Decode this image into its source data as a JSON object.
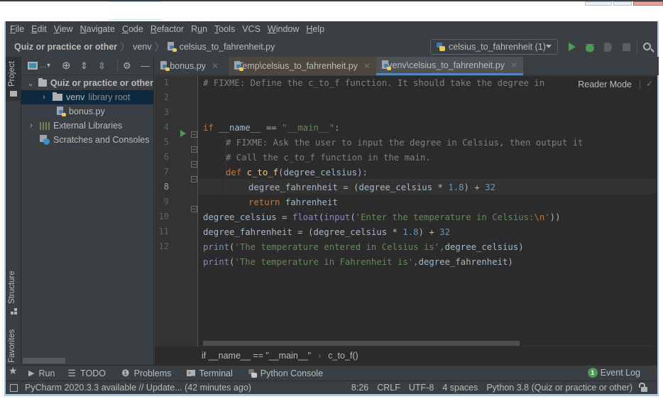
{
  "menu": [
    "File",
    "Edit",
    "View",
    "Navigate",
    "Code",
    "Refactor",
    "Run",
    "Tools",
    "VCS",
    "Window",
    "Help"
  ],
  "menu_mnemonics": [
    "F",
    "E",
    "V",
    "N",
    "C",
    "R",
    "u",
    "T",
    "",
    "W",
    "H"
  ],
  "navbar": {
    "breadcrumbs": [
      "Quiz or practice or other",
      "venv",
      "celsius_to_fahrenheit.py"
    ],
    "run_config": "celsius_to_fahrenheit (1)"
  },
  "left_strip": {
    "project": "Project",
    "structure": "Structure",
    "favorites": "Favorites"
  },
  "project_tree": {
    "root": "Quiz or practice or other",
    "venv": "venv",
    "venv_hint": "library root",
    "file": "bonus.py",
    "external": "External Libraries",
    "scratches": "Scratches and Consoles"
  },
  "tabs": [
    {
      "label": "bonus.py",
      "active": false
    },
    {
      "label": "Temp\\celsius_to_fahrenheit.py",
      "active": false
    },
    {
      "label": "venv\\celsius_to_fahrenheit.py",
      "active": true
    }
  ],
  "editor": {
    "reader_mode": "Reader Mode",
    "current_line": 8,
    "line_numbers": [
      "1",
      "2",
      "3",
      "4",
      "5",
      "6",
      "7",
      "8",
      "9",
      "10",
      "11",
      "12"
    ],
    "lines": {
      "l1": "# FIXME: Define the c_to_f function. It should take the degree in",
      "l3_kw": "if",
      "l3_rest": " __name__ == ",
      "l3_str": "\"__main__\"",
      "l3_end": ":",
      "l4": "# FIXME: Ask the user to input the degree in Celsius, then output it",
      "l5": "# Call the c_to_f function in the main.",
      "l6_kw": "def ",
      "l6_fn": "c_to_f",
      "l6_rest": "(degree_celsius):",
      "l7_a": "degree_fahrenheit = (degree_celsius * ",
      "l7_n1": "1.8",
      "l7_b": ") + ",
      "l7_n2": "32",
      "l8_kw": "return ",
      "l8_rest": "fahrenheit",
      "l9_a": "degree_celsius = ",
      "l9_bi1": "float",
      "l9_b": "(",
      "l9_bi2": "input",
      "l9_c": "(",
      "l9_str": "'Enter the temperature in Celsius:",
      "l9_esc": "\\n",
      "l9_str2": "'",
      "l9_end": "))",
      "l10_a": "degree_fahrenheit = (degree_celsius * ",
      "l10_n1": "1.8",
      "l10_b": ") + ",
      "l10_n2": "32",
      "l11_bi": "print",
      "l11_a": "(",
      "l11_str": "'The temperature entered in Celsius is'",
      "l11_comma": ",",
      "l11_end": "degree_celsius)",
      "l12_bi": "print",
      "l12_a": "(",
      "l12_str": "'The temperature in Fahrenheit is'",
      "l12_comma": ",",
      "l12_end": "degree_fahrenheit)"
    }
  },
  "code_breadcrumb": [
    "if __name__ == \"__main__\"",
    "c_to_f()"
  ],
  "tool_windows": [
    "Run",
    "TODO",
    "Problems",
    "Terminal",
    "Python Console"
  ],
  "event_log": {
    "count": "1",
    "label": "Event Log"
  },
  "status": {
    "message": "PyCharm 2020.3.3 available // Update... (42 minutes ago)",
    "position": "8:26",
    "line_sep": "CRLF",
    "encoding": "UTF-8",
    "indent": "4 spaces",
    "interpreter": "Python 3.8 (Quiz or practice or other)"
  },
  "colors": {
    "accent": "#4a88c7",
    "run_green": "#499c54",
    "keyword": "#cc7832",
    "string": "#6a8759",
    "number": "#6897bb",
    "function": "#ffc66d",
    "comment": "#808080"
  }
}
